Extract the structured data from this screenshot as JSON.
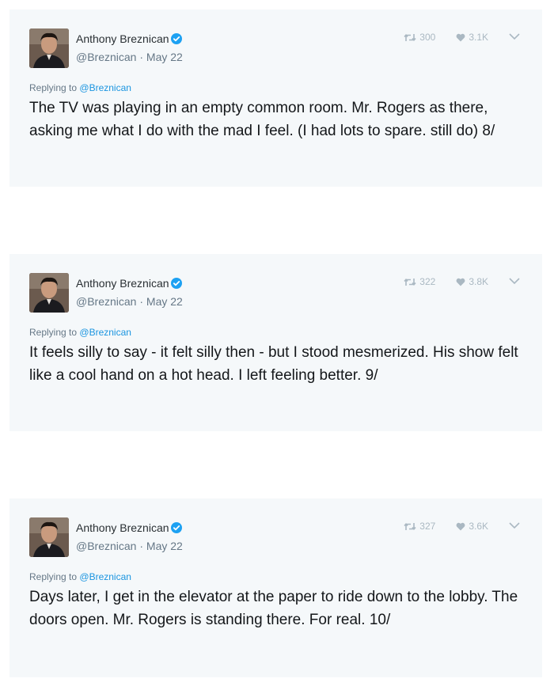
{
  "colors": {
    "card_bg": "#f5f8fa",
    "link": "#1b95e0",
    "verified": "#1da1f2",
    "meta": "#657786",
    "icon": "#aab8c2"
  },
  "tweets": [
    {
      "author": "Anthony Breznican",
      "handle_date": "@Breznican · May 22",
      "retweets": "300",
      "likes": "3.1K",
      "replying_prefix": "Replying to",
      "replying_handle": "@Breznican",
      "text": "The TV was playing in an empty common room. Mr. Rogers as there, asking me what I do with the mad I feel. (I had lots to spare. still do) 8/"
    },
    {
      "author": "Anthony Breznican",
      "handle_date": "@Breznican · May 22",
      "retweets": "322",
      "likes": "3.8K",
      "replying_prefix": "Replying to",
      "replying_handle": "@Breznican",
      "text": "It feels silly to say - it felt silly then - but I stood mesmerized. His show felt like a cool hand on a hot head. I left feeling better. 9/"
    },
    {
      "author": "Anthony Breznican",
      "handle_date": "@Breznican · May 22",
      "retweets": "327",
      "likes": "3.6K",
      "replying_prefix": "Replying to",
      "replying_handle": "@Breznican",
      "text": "Days later, I get in the elevator at the paper to ride down to the lobby. The doors open. Mr. Rogers is standing there. For real. 10/"
    }
  ],
  "icons": {
    "avatar": "avatar-photo",
    "verified": "verified-badge-icon",
    "retweet": "retweet-icon",
    "like": "heart-icon",
    "menu": "chevron-down-icon"
  }
}
